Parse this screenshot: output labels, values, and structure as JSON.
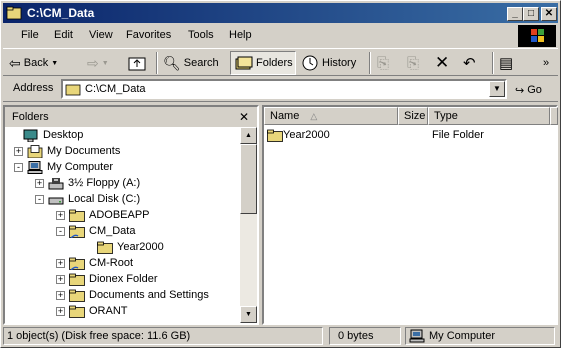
{
  "window": {
    "title": "C:\\CM_Data",
    "min_label": "_",
    "max_label": "□",
    "close_label": "✕"
  },
  "menu": [
    "File",
    "Edit",
    "View",
    "Favorites",
    "Tools",
    "Help"
  ],
  "toolbar": {
    "back": "Back",
    "search": "Search",
    "folders": "Folders",
    "history": "History"
  },
  "address": {
    "label": "Address",
    "value": "C:\\CM_Data",
    "go": "Go"
  },
  "folders_pane": {
    "title": "Folders",
    "close": "✕"
  },
  "tree": [
    {
      "label": "Desktop",
      "icon": "desktop-icon",
      "expander": ""
    },
    {
      "label": "My Documents",
      "icon": "my-documents-icon",
      "expander": "+"
    },
    {
      "label": "My Computer",
      "icon": "my-computer-icon",
      "expander": "-"
    },
    {
      "label": "3½ Floppy (A:)",
      "icon": "floppy-drive-icon",
      "expander": "+"
    },
    {
      "label": "Local Disk (C:)",
      "icon": "hard-drive-icon",
      "expander": "-"
    },
    {
      "label": "ADOBEAPP",
      "icon": "folder-icon",
      "expander": "+"
    },
    {
      "label": "CM_Data",
      "icon": "shared-folder-icon",
      "expander": "-"
    },
    {
      "label": "Year2000",
      "icon": "folder-icon",
      "expander": ""
    },
    {
      "label": "CM-Root",
      "icon": "shared-folder-icon",
      "expander": "+"
    },
    {
      "label": "Dionex Folder",
      "icon": "folder-icon",
      "expander": "+"
    },
    {
      "label": "Documents and Settings",
      "icon": "folder-icon",
      "expander": "+"
    },
    {
      "label": "ORANT",
      "icon": "folder-icon",
      "expander": "+"
    }
  ],
  "list": {
    "columns": [
      "Name",
      "Size",
      "Type"
    ],
    "rows": [
      {
        "name": "Year2000",
        "size": "",
        "type": "File Folder"
      }
    ]
  },
  "status": {
    "objects": "1 object(s) (Disk free space: 11.6 GB)",
    "size": "0 bytes",
    "zone": "My Computer"
  }
}
